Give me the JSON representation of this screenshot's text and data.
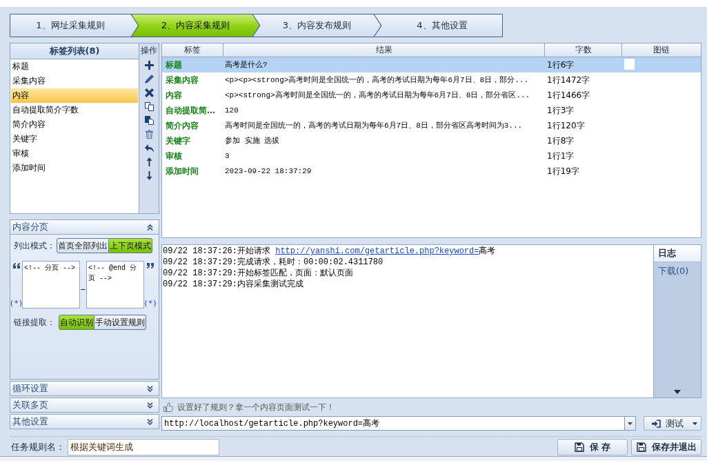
{
  "steps": [
    {
      "label": "1、网址采集规则",
      "selected": false
    },
    {
      "label": "2、内容采集规则",
      "selected": true
    },
    {
      "label": "3、内容发布规则",
      "selected": false
    },
    {
      "label": "4、其他设置",
      "selected": false
    }
  ],
  "tag_list": {
    "title": "标签列表(8)",
    "items": [
      {
        "label": "标题",
        "selected": false
      },
      {
        "label": "采集内容",
        "selected": false
      },
      {
        "label": "内容",
        "selected": true
      },
      {
        "label": "自动提取简介字数",
        "selected": false
      },
      {
        "label": "简介内容",
        "selected": false
      },
      {
        "label": "关键字",
        "selected": false
      },
      {
        "label": "审核",
        "selected": false
      },
      {
        "label": "添加时间",
        "selected": false
      }
    ]
  },
  "operations": {
    "title": "操作"
  },
  "sections": [
    {
      "title": "内容分页",
      "expanded": true,
      "list_mode": {
        "label": "列出模式：",
        "options": [
          {
            "label": "首页全部列出",
            "selected": false
          },
          {
            "label": "上下页模式",
            "selected": true
          }
        ]
      },
      "start_marker": "<!-- 分页 -->",
      "joiner": "_",
      "end_marker": "<!-- @end 分页 -->",
      "wildcard_left": "(*)",
      "wildcard_right": "(*)",
      "link_extract": {
        "label": "链接提取：",
        "options": [
          {
            "label": "自动识别",
            "selected": true
          },
          {
            "label": "手动设置规则",
            "selected": false
          }
        ]
      }
    },
    {
      "title": "循环设置",
      "expanded": false
    },
    {
      "title": "关联多页",
      "expanded": false
    },
    {
      "title": "其他设置",
      "expanded": false
    }
  ],
  "table": {
    "columns": [
      "标签",
      "结果",
      "字数",
      "图链"
    ],
    "rows": [
      {
        "tag": "标题",
        "result": "高考是什么?",
        "count": "1行6字",
        "selected": true
      },
      {
        "tag": "采集内容",
        "result": "<p><p><strong>高考时间是全国统一的，高考的考试日期为每年6月7日、8日，部分...",
        "count": "1行1472字",
        "selected": false
      },
      {
        "tag": "内容",
        "result": "<p><strong>高考时间是全国统一的，高考的考试日期为每年6月7日、8日，部分省区...",
        "count": "1行1466字",
        "selected": false
      },
      {
        "tag": "自动提取简…",
        "result": "120",
        "count": "1行3字",
        "selected": false
      },
      {
        "tag": "简介内容",
        "result": "高考时间是全国统一的，高考的考试日期为每年6月7日、8日，部分省区高考时间为3...",
        "count": "1行120字",
        "selected": false
      },
      {
        "tag": "关键字",
        "result": "参加 实施 选拔",
        "count": "1行8字",
        "selected": false
      },
      {
        "tag": "审核",
        "result": "3",
        "count": "1行1字",
        "selected": false
      },
      {
        "tag": "添加时间",
        "result": "2023-09-22 18:37:29",
        "count": "1行19字",
        "selected": false
      }
    ]
  },
  "log": {
    "lines": [
      {
        "text": "09/22 18:37:26:开始请求 ",
        "link": "http://yanshi.com/getarticle.php?keyword=",
        "tail": "高考"
      },
      {
        "text": "09/22 18:37:29:完成请求，耗时：00:00:02.4311780"
      },
      {
        "text": "09/22 18:37:29:开始标签匹配，页面：默认页面"
      },
      {
        "text": "09/22 18:37:29:内容采集测试完成"
      }
    ],
    "tabs": [
      {
        "label": "日志",
        "selected": true
      },
      {
        "label": "下载(0)",
        "selected": false
      }
    ]
  },
  "test": {
    "hint": "设置好了规则？拿一个内容页面测试一下！",
    "url": "http://localhost/getarticle.php?keyword=高考",
    "button": "测试"
  },
  "task_name": {
    "label": "任务规则名：",
    "value": "根据关键词生成"
  },
  "buttons": [
    {
      "label": "保 存"
    },
    {
      "label": "保存并退出"
    }
  ]
}
